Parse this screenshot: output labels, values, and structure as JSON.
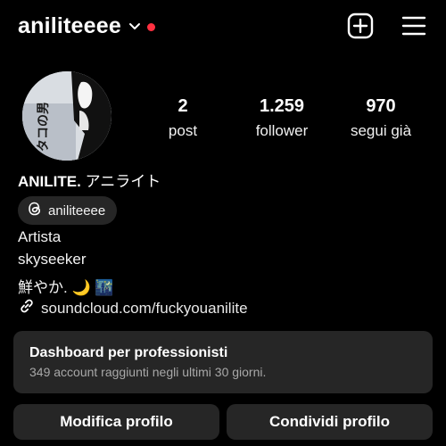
{
  "colors": {
    "background": "#000000",
    "surface": "#262626",
    "notification_dot": "#ff3040",
    "text": "#ffffff",
    "muted": "#a8a8a8"
  },
  "header": {
    "username": "aniliteeee",
    "icons": [
      "chevron-down-icon",
      "notification-dot",
      "new-post-icon",
      "menu-icon"
    ]
  },
  "profile": {
    "avatar_text": "タコの男",
    "stats": [
      {
        "value": "2",
        "label": "post"
      },
      {
        "value": "1.259",
        "label": "follower"
      },
      {
        "value": "970",
        "label": "segui già"
      }
    ],
    "display_name": "ANILITE.",
    "display_name_jp": "アニライト",
    "threads_handle": "aniliteeee",
    "bio": [
      "Artista",
      "skyseeker",
      "鮮やか. 🌙 🌃"
    ],
    "link": "soundcloud.com/fuckyouanilite"
  },
  "dashboard": {
    "title": "Dashboard per professionisti",
    "subtitle": "349 account raggiunti negli ultimi 30 giorni."
  },
  "actions": {
    "edit_profile": "Modifica profilo",
    "share_profile": "Condividi profilo"
  }
}
